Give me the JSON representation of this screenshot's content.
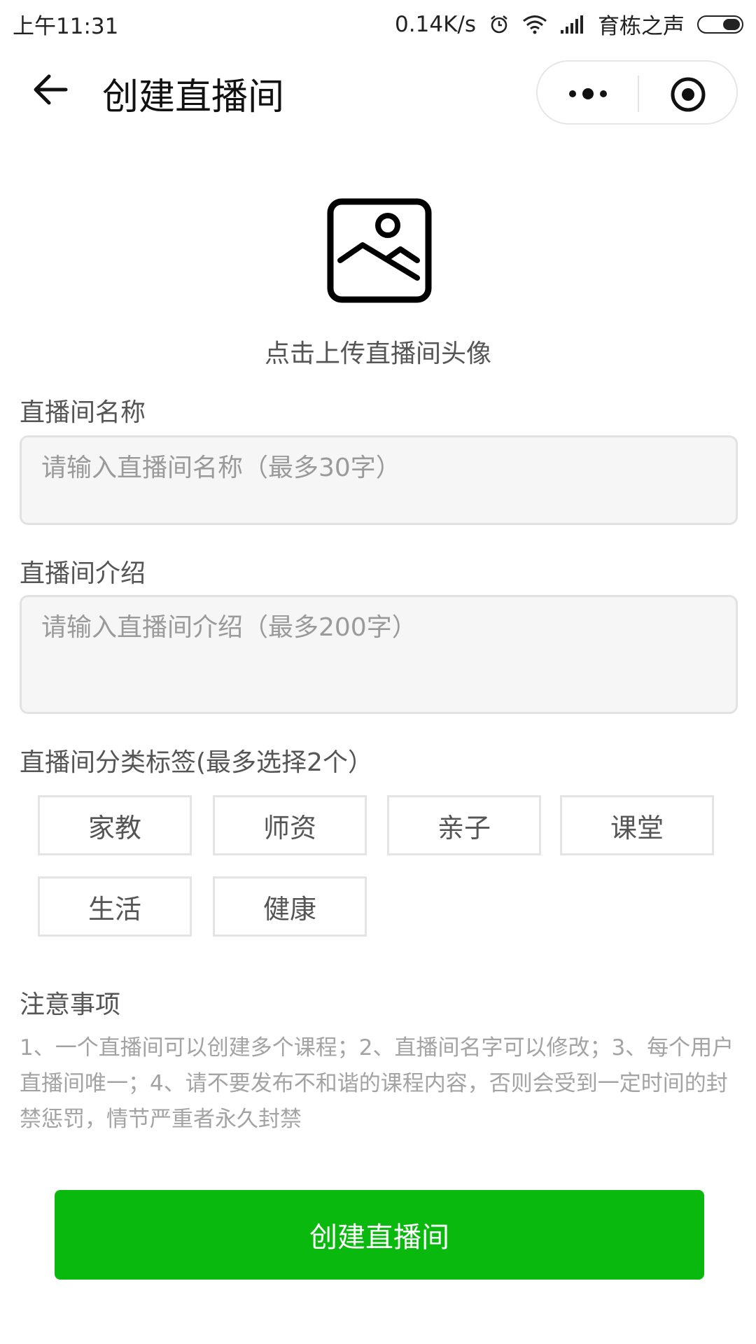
{
  "status_bar": {
    "time": "上午11:31",
    "network_speed": "0.14K/s",
    "carrier": "育栋之声",
    "icons": [
      "alarm-icon",
      "wifi-icon",
      "signal-icon",
      "battery-icon"
    ]
  },
  "nav": {
    "title": "创建直播间",
    "back_icon": "arrow-left-icon",
    "more_icon": "more-dots-icon",
    "close_icon": "target-circle-icon"
  },
  "upload": {
    "icon": "image-placeholder-icon",
    "label": "点击上传直播间头像"
  },
  "form": {
    "name_label": "直播间名称",
    "name_placeholder": "请输入直播间名称（最多30字）",
    "intro_label": "直播间介绍",
    "intro_placeholder": "请输入直播间介绍（最多200字）",
    "tags_label": "直播间分类标签(最多选择2个）",
    "tags": [
      "家教",
      "师资",
      "亲子",
      "课堂",
      "生活",
      "健康"
    ]
  },
  "notes": {
    "title": "注意事项",
    "text": "1、一个直播间可以创建多个课程；2、直播间名字可以修改；3、每个用户直播间唯一；4、请不要发布不和谐的课程内容，否则会受到一定时间的封禁惩罚，情节严重者永久封禁"
  },
  "submit_button": "创建直播间",
  "colors": {
    "primary": "#0ab90e",
    "input_bg": "#f6f6f6",
    "border": "#e4e4e4",
    "muted_text": "#a3a3a3"
  }
}
